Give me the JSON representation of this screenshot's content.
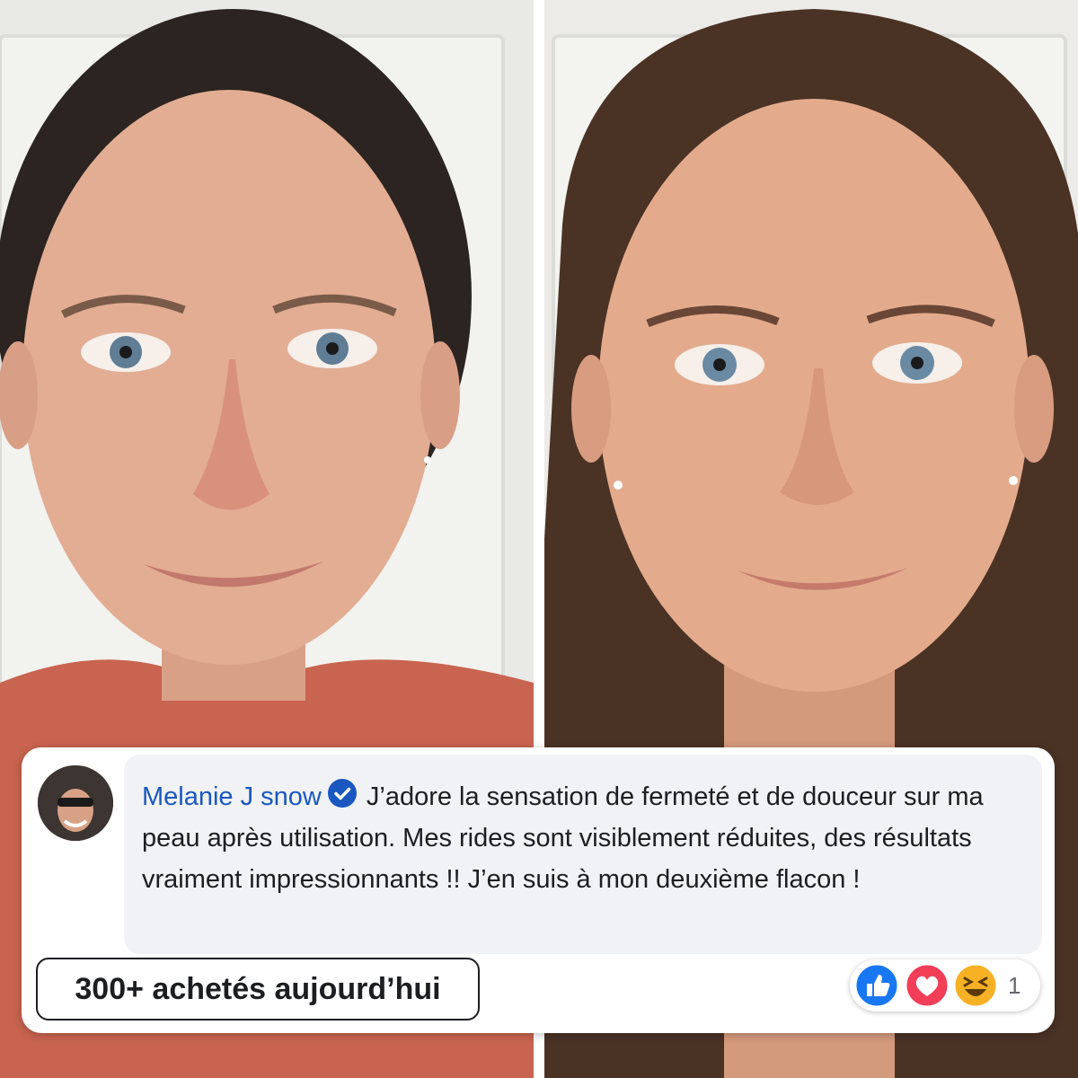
{
  "photos": {
    "before": {
      "icon": "before-portrait"
    },
    "after": {
      "icon": "after-portrait"
    }
  },
  "comment": {
    "author": "Melanie J snow",
    "verified_icon": "verified-badge-icon",
    "text": "J’adore la sensation de fermeté et de douceur sur ma peau après utilisation. Mes rides sont visiblement réduites, des résultats vraiment impressionnants !! J’en suis à mon deuxième flacon !"
  },
  "badge": {
    "label": "300+ achetés aujourd’hui"
  },
  "reactions": {
    "icons": [
      "like-icon",
      "love-icon",
      "haha-icon"
    ],
    "count": "1"
  },
  "colors": {
    "author": "#1a57c0",
    "bubble": "#f0f2f5",
    "like": "#1877f2",
    "love": "#f33e58",
    "haha": "#f7b125"
  }
}
